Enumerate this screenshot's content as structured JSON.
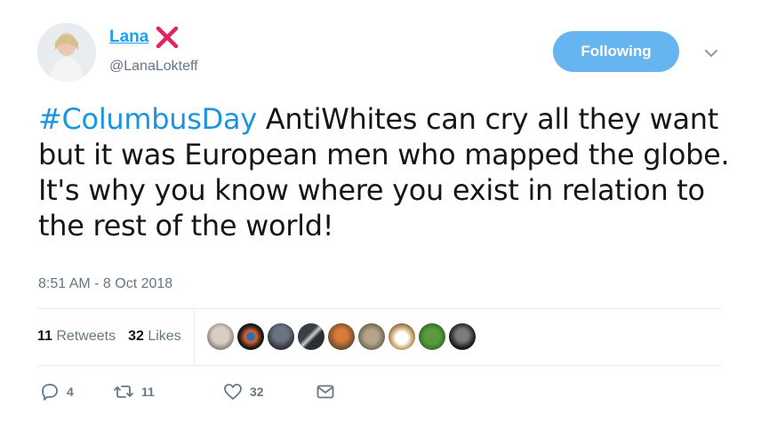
{
  "user": {
    "display_name": "Lana",
    "handle": "@LanaLokteff",
    "badge_icon": "red-x-icon"
  },
  "follow_button": {
    "label": "Following"
  },
  "tweet": {
    "hashtag": "#ColumbusDay",
    "text": " AntiWhites can cry all they want but it was European men who mapped the globe. It's why you know where you exist in relation to the rest of the world!",
    "timestamp": "8:51 AM - 8 Oct 2018"
  },
  "stats": {
    "retweets_count": "11",
    "retweets_label": "Retweets",
    "likes_count": "32",
    "likes_label": "Likes"
  },
  "actions": {
    "reply_count": "4",
    "retweet_count": "11",
    "like_count": "32"
  },
  "colors": {
    "accent": "#1da1f2",
    "follow_button": "#66b5f0",
    "muted": "#657786"
  }
}
